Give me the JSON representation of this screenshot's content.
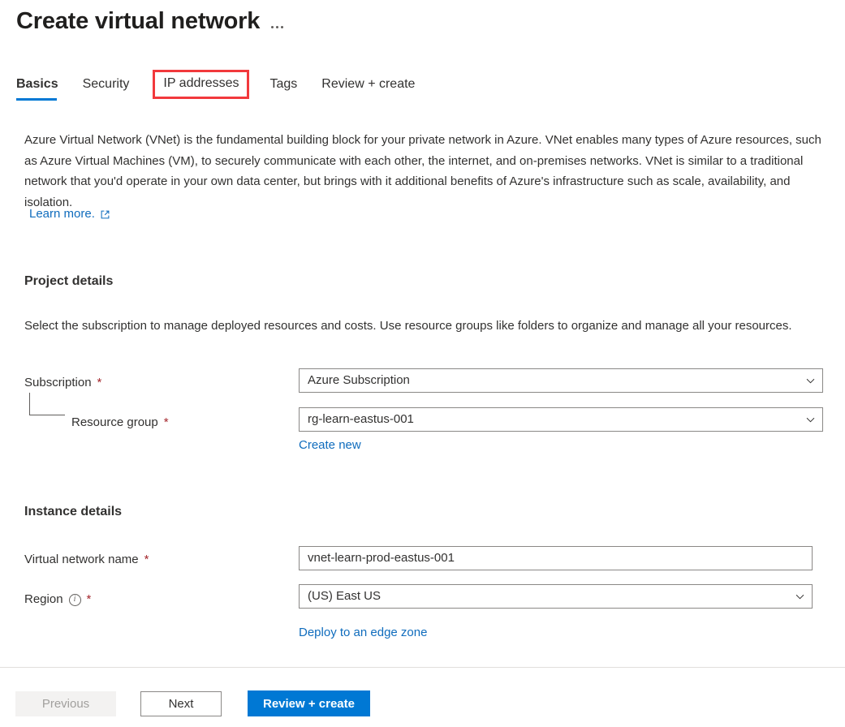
{
  "header": {
    "title": "Create virtual network",
    "more_menu": "..."
  },
  "tabs": [
    {
      "label": "Basics",
      "state": "active"
    },
    {
      "label": "Security",
      "state": "normal"
    },
    {
      "label": "IP addresses",
      "state": "highlighted"
    },
    {
      "label": "Tags",
      "state": "normal"
    },
    {
      "label": "Review + create",
      "state": "normal"
    }
  ],
  "intro": {
    "paragraph": "Azure Virtual Network (VNet) is the fundamental building block for your private network in Azure. VNet enables many types of Azure resources, such as Azure Virtual Machines (VM), to securely communicate with each other, the internet, and on-premises networks. VNet is similar to a traditional network that you'd operate in your own data center, but brings with it additional benefits of Azure's infrastructure such as scale, availability, and isolation.",
    "learn_more": "Learn more.",
    "learn_more_icon": "external-link-icon"
  },
  "project_details": {
    "heading": "Project details",
    "description": "Select the subscription to manage deployed resources and costs. Use resource groups like folders to organize and manage all your resources.",
    "subscription": {
      "label": "Subscription",
      "required_marker": "*",
      "value": "Azure Subscription",
      "chevron": "chevron-down-icon"
    },
    "resource_group": {
      "label": "Resource group",
      "required_marker": "*",
      "value": "rg-learn-eastus-001",
      "chevron": "chevron-down-icon",
      "create_new_link": "Create new"
    }
  },
  "instance_details": {
    "heading": "Instance details",
    "vnet_name": {
      "label": "Virtual network name",
      "required_marker": "*",
      "value": "vnet-learn-prod-eastus-001",
      "placeholder": ""
    },
    "region": {
      "label": "Region",
      "required_marker": "*",
      "info_icon": "info-icon",
      "value": "(US) East US",
      "chevron": "chevron-down-icon",
      "edge_zone_link": "Deploy to an edge zone"
    }
  },
  "footer": {
    "previous": "Previous",
    "next": "Next",
    "review_create": "Review + create"
  },
  "colors": {
    "accent": "#0078d4",
    "link": "#0f6cbd",
    "required": "#a4262c",
    "highlight_box": "#f2393c",
    "border": "#8a8886",
    "text": "#323130"
  }
}
